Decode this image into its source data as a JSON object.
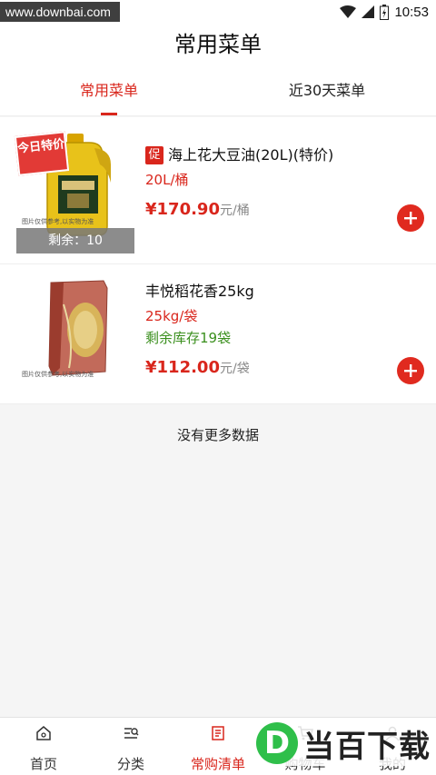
{
  "status_bar": {
    "watermark": "www.downbai.com",
    "time": "10:53"
  },
  "header": {
    "title": "常用菜单"
  },
  "tabs": [
    {
      "label": "常用菜单",
      "active": true
    },
    {
      "label": "近30天菜单",
      "active": false
    }
  ],
  "items": [
    {
      "promo_tag": "今日特价",
      "promo_badge": "促",
      "name": "海上花大豆油(20L)(特价)",
      "unit": "20L/桶",
      "price": "¥170.90",
      "price_unit": "元/桶",
      "remaining": "剩余：10",
      "image_caption": "图片仅供参考,以实物为准"
    },
    {
      "name": "丰悦稻花香25kg",
      "unit": "25kg/袋",
      "stock": "剩余库存19袋",
      "price": "¥112.00",
      "price_unit": "元/袋",
      "image_caption": "图片仅供参考,以实物为准"
    }
  ],
  "no_more": "没有更多数据",
  "bottom_nav": [
    {
      "label": "首页",
      "icon": "home-icon"
    },
    {
      "label": "分类",
      "icon": "category-icon"
    },
    {
      "label": "常购清单",
      "icon": "list-icon",
      "active": true
    },
    {
      "label": "购物车",
      "icon": "cart-icon"
    },
    {
      "label": "我的",
      "icon": "user-icon"
    }
  ],
  "logo": {
    "letter": "D",
    "text": "当百下载"
  },
  "colors": {
    "accent": "#d9261c",
    "stock_green": "#3a8f1d",
    "logo_green": "#2fbf4a"
  }
}
